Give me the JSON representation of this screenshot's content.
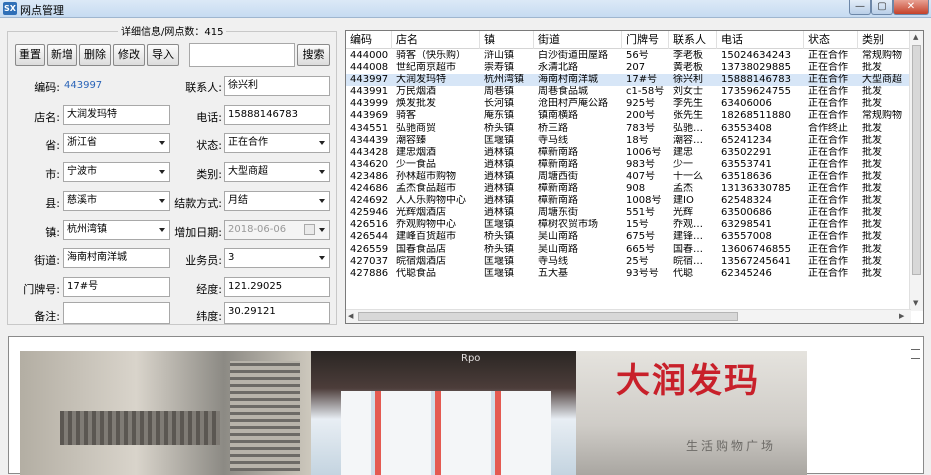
{
  "window": {
    "title": "网点管理",
    "icon_text": "SX",
    "min_glyph": "—",
    "max_glyph": "▢",
    "close_glyph": "✕"
  },
  "form": {
    "group_title": "详细信息/网点数：415",
    "toolbar": {
      "reset": "重置",
      "add": "新增",
      "delete": "删除",
      "modify": "修改",
      "import": "导入",
      "search_value": "",
      "search": "搜索"
    },
    "labels": {
      "code": "编码:",
      "contact": "联系人:",
      "name": "店名:",
      "phone": "电话:",
      "province": "省:",
      "status": "状态:",
      "city": "市:",
      "category": "类别:",
      "county": "县:",
      "settle": "结款方式:",
      "town": "镇:",
      "add_date": "增加日期:",
      "street": "街道:",
      "salesman": "业务员:",
      "door": "门牌号:",
      "lng": "经度:",
      "remark": "备注:",
      "lat": "纬度:"
    },
    "values": {
      "code": "443997",
      "contact": "徐兴利",
      "name": "大润发玛特",
      "phone": "15888146783",
      "province": "浙江省",
      "status": "正在合作",
      "city": "宁波市",
      "category": "大型商超",
      "county": "慈溪市",
      "settle": "月结",
      "town": "杭州湾镇",
      "add_date": "2018-06-06",
      "street": "海南村南洋城",
      "salesman": "3",
      "door": "17#号",
      "lng": "121.29025",
      "remark": "",
      "lat": "30.29121"
    }
  },
  "table": {
    "columns": [
      "编码",
      "店名",
      "镇",
      "街道",
      "门牌号",
      "联系人",
      "电话",
      "状态",
      "类别"
    ],
    "selected_index": 2,
    "rows": [
      [
        "444000",
        "骑客（快乐购）",
        "浒山镇",
        "白沙街道田屋路",
        "56号",
        "李老板",
        "15024634243",
        "正在合作",
        "常规购物"
      ],
      [
        "444008",
        "世纪南京超市",
        "崇寿镇",
        "永清北路",
        "207",
        "黄老板",
        "13738029885",
        "正在合作",
        "批发"
      ],
      [
        "443997",
        "大润发玛特",
        "杭州湾镇",
        "海南村南洋城",
        "17#号",
        "徐兴利",
        "15888146783",
        "正在合作",
        "大型商超"
      ],
      [
        "443991",
        "万民烟酒",
        "周巷镇",
        "周巷食品城",
        "c1-58号",
        "刘女士",
        "17359624755",
        "正在合作",
        "批发"
      ],
      [
        "443999",
        "焕发批发",
        "长河镇",
        "沧田村芦庵公路",
        "925号",
        "李先生",
        "63406006",
        "正在合作",
        "批发"
      ],
      [
        "443969",
        "骑客",
        "庵东镇",
        "镇南横路",
        "200号",
        "张先生",
        "18268511880",
        "正在合作",
        "常规购物"
      ],
      [
        "434551",
        "弘驰商贸",
        "桥头镇",
        "桥三路",
        "783号",
        "弘驰…",
        "63553408",
        "合作终止",
        "批发"
      ],
      [
        "434439",
        "潮容臻",
        "匡堰镇",
        "寺马线",
        "18号",
        "潮容…",
        "65241234",
        "正在合作",
        "批发"
      ],
      [
        "443428",
        "建忠烟酒",
        "逍林镇",
        "樟新南路",
        "1006号",
        "建忠",
        "63502291",
        "正在合作",
        "批发"
      ],
      [
        "434620",
        "少一食品",
        "逍林镇",
        "樟新南路",
        "983号",
        "少一",
        "63553741",
        "正在合作",
        "批发"
      ],
      [
        "423486",
        "孙林超市购物",
        "逍林镇",
        "周塘西街",
        "407号",
        "十一么",
        "63518636",
        "正在合作",
        "批发"
      ],
      [
        "424686",
        "孟杰食品超市",
        "逍林镇",
        "樟新南路",
        "908",
        "孟杰",
        "13136330785",
        "正在合作",
        "批发"
      ],
      [
        "424692",
        "人人乐购物中心",
        "逍林镇",
        "樟新南路",
        "1008号",
        "建IO",
        "62548324",
        "正在合作",
        "批发"
      ],
      [
        "425946",
        "光辉烟酒店",
        "逍林镇",
        "周塘东街",
        "551号",
        "光辉",
        "63500686",
        "正在合作",
        "批发"
      ],
      [
        "426516",
        "乔观购物中心",
        "匡堰镇",
        "樟树农贸市场",
        "15号",
        "乔观…",
        "63298541",
        "正在合作",
        "批发"
      ],
      [
        "426544",
        "建峰百货超市",
        "桥头镇",
        "吴山南路",
        "675号",
        "建锋…",
        "63557008",
        "正在合作",
        "批发"
      ],
      [
        "426559",
        "国春食品店",
        "桥头镇",
        "吴山南路",
        "665号",
        "国春…",
        "13606746855",
        "正在合作",
        "批发"
      ],
      [
        "427037",
        "皖宿烟酒店",
        "匡堰镇",
        "寺马线",
        "25号",
        "皖宿…",
        "13567245641",
        "正在合作",
        "批发"
      ],
      [
        "427886",
        "代聪食品",
        "匡堰镇",
        "五大基",
        "93号号",
        "代聪",
        "62345246",
        "正在合作",
        "批发"
      ]
    ]
  },
  "photos": {
    "store_sign": "大润发玛",
    "store_sub": "生活购物广场",
    "photo_caption": "Rpo"
  }
}
